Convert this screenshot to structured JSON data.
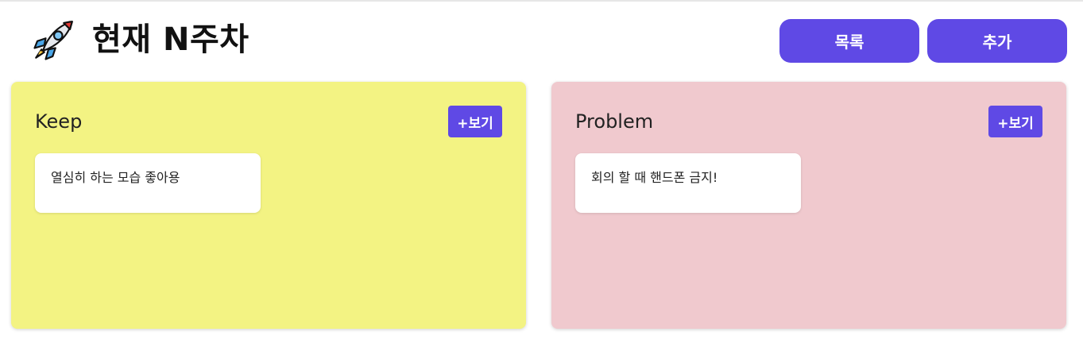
{
  "header": {
    "title": "현재 N주차",
    "list_button_label": "목록",
    "add_button_label": "추가"
  },
  "panels": [
    {
      "title": "Keep",
      "view_button_label": "+보기",
      "notes": [
        "열심히 하는 모습 좋아용"
      ]
    },
    {
      "title": "Problem",
      "view_button_label": "+보기",
      "notes": [
        "회의 할 때 핸드폰 금지!"
      ]
    }
  ],
  "colors": {
    "accent": "#5f49e5",
    "keep_panel": "#f3f383",
    "problem_panel": "#f0c9ce"
  },
  "icons": {
    "title_icon": "rocket-icon"
  }
}
